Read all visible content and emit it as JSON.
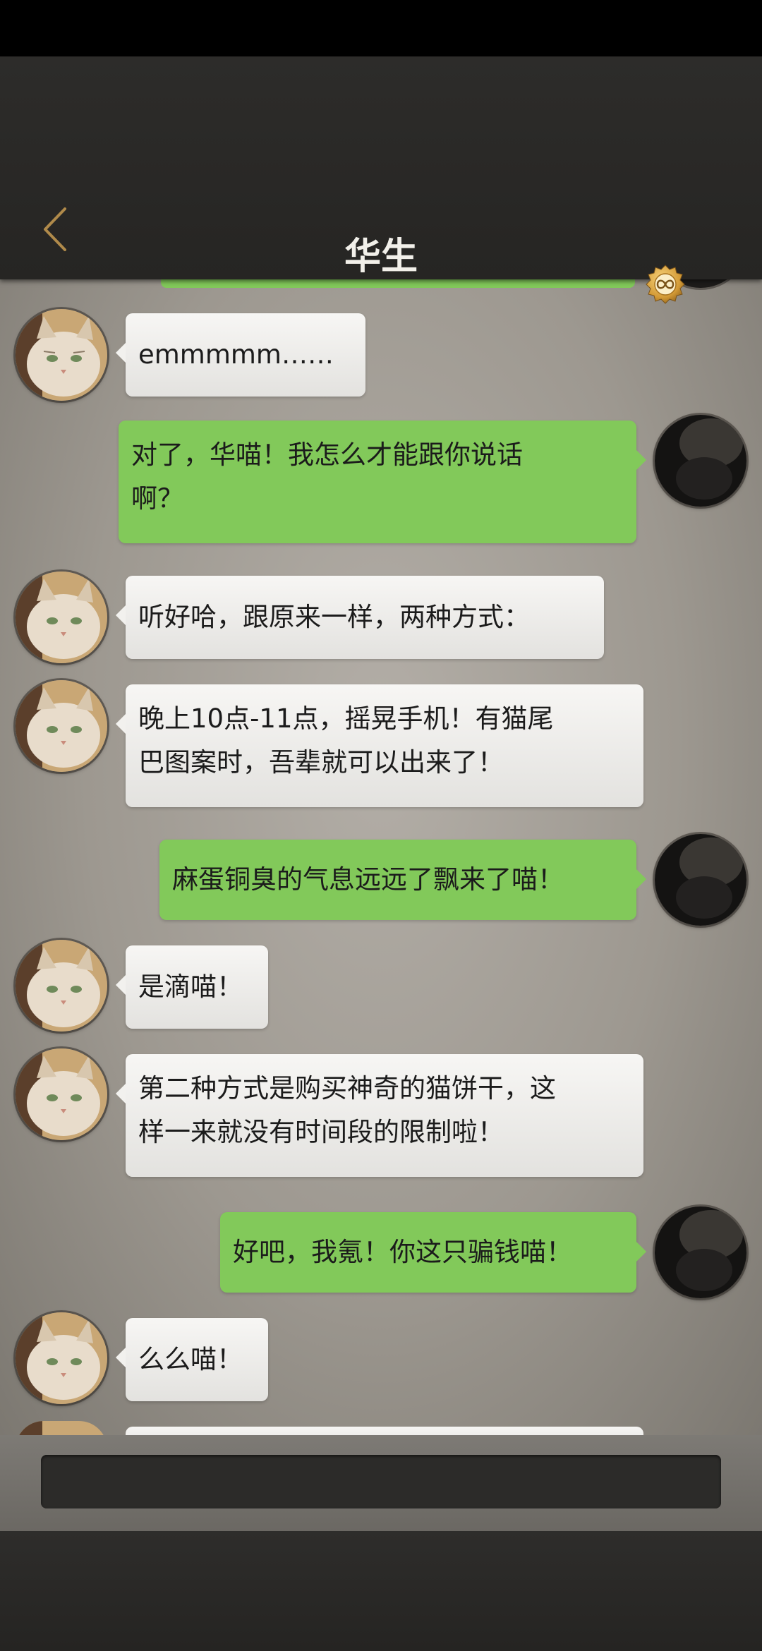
{
  "header": {
    "title": "华生",
    "back_icon": "chevron-left-icon",
    "coin_icon": "infinity-coin-icon",
    "accent_color": "#d9a441"
  },
  "messages": [
    {
      "sender": "cat",
      "text": [
        "emmmmm……"
      ]
    },
    {
      "sender": "me",
      "text": [
        "对了，华喵！我怎么才能跟你说话",
        "啊？"
      ]
    },
    {
      "sender": "cat",
      "text": [
        "听好哈，跟原来一样，两种方式："
      ]
    },
    {
      "sender": "cat",
      "text": [
        "晚上10点-11点，摇晃手机！有猫尾",
        "巴图案时，吾辈就可以出来了！"
      ]
    },
    {
      "sender": "me",
      "text": [
        "麻蛋铜臭的气息远远了飘来了喵！"
      ]
    },
    {
      "sender": "cat",
      "text": [
        "是滴喵！"
      ]
    },
    {
      "sender": "cat",
      "text": [
        "第二种方式是购买神奇的猫饼干，这",
        "样一来就没有时间段的限制啦！"
      ]
    },
    {
      "sender": "me",
      "text": [
        "好吧，我氪！你这只骗钱喵！"
      ]
    },
    {
      "sender": "cat",
      "text": [
        "么么喵！"
      ]
    }
  ],
  "colors": {
    "my_bubble": "#82c95a",
    "cat_bubble": "#f2f1ee"
  }
}
